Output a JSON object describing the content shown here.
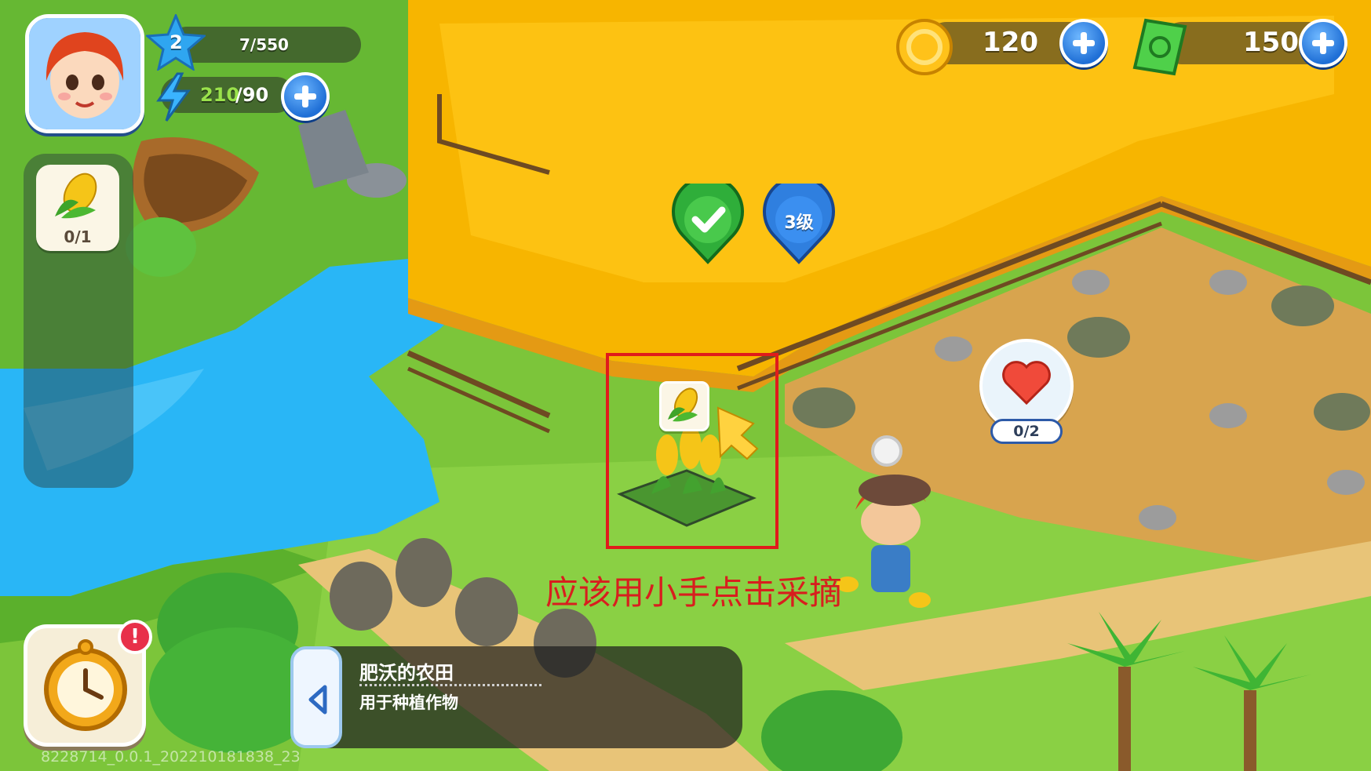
{
  "player": {
    "level": "2",
    "xp": "7/550",
    "energy_current": "210",
    "energy_max": "/90"
  },
  "currencies": {
    "coins": "120",
    "cash": "150"
  },
  "quest_panel": {
    "corn_progress": "0/1"
  },
  "field": {
    "level_badge": "3级",
    "heart_progress": "0/2"
  },
  "annotation": {
    "text": "应该用小手点击采摘",
    "color": "#d81e1e"
  },
  "tooltip": {
    "title": "肥沃的农田",
    "subtitle": "用于种植作物"
  },
  "build_info": "8228714_0.0.1_202210181838_23",
  "colors": {
    "accent_blue": "#1f6fd6",
    "wheat": "#f7b500",
    "grass": "#7cc53a",
    "water": "#29b6f6",
    "dirt": "#d8a44e"
  }
}
